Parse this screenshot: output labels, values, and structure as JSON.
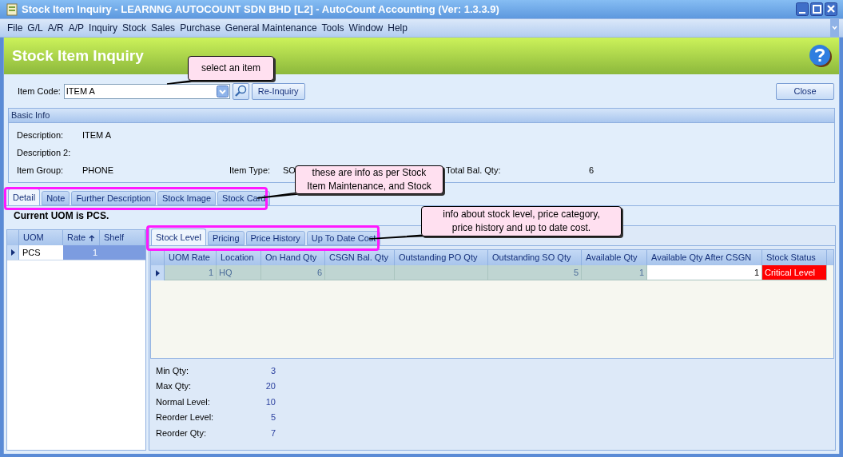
{
  "window": {
    "title": "Stock Item Inquiry - LEARNNG AUTOCOUNT SDN BHD [L2] - AutoCount Accounting (Ver: 1.3.3.9)"
  },
  "menu": [
    {
      "label": "File"
    },
    {
      "label": "G/L"
    },
    {
      "label": "A/R"
    },
    {
      "label": "A/P"
    },
    {
      "label": "Inquiry"
    },
    {
      "label": "Stock"
    },
    {
      "label": "Sales"
    },
    {
      "label": "Purchase"
    },
    {
      "label": "General Maintenance"
    },
    {
      "label": "Tools"
    },
    {
      "label": "Window"
    },
    {
      "label": "Help"
    }
  ],
  "header": {
    "title": "Stock Item Inquiry"
  },
  "item_code": {
    "label": "Item Code:",
    "value": "ITEM A"
  },
  "buttons": {
    "re_inquiry": "Re-Inquiry",
    "close": "Close"
  },
  "basic_info": {
    "title": "Basic Info",
    "rows": [
      [
        {
          "label": "Description:",
          "value": "ITEM A"
        }
      ],
      [
        {
          "label": "Description 2:"
        }
      ],
      [
        {
          "label": "Item Group:",
          "value": "PHONE"
        },
        {
          "label": "Item Type:",
          "value": "SO"
        },
        {
          "label": "Total Bal. Qty:",
          "value": "6"
        }
      ]
    ]
  },
  "tabs": [
    {
      "label": "Detail",
      "selected": true
    },
    {
      "label": "Note",
      "selected": false
    },
    {
      "label": "Further Description",
      "selected": false
    },
    {
      "label": "Stock Image",
      "selected": false
    },
    {
      "label": "Stock Card",
      "selected": false
    }
  ],
  "current_uom": "Current UOM is PCS.",
  "uom_grid": {
    "columns": [
      {
        "label": "UOM",
        "sorted": false
      },
      {
        "label": "Rate",
        "sorted": true
      },
      {
        "label": "Shelf",
        "sorted": false
      }
    ],
    "rows": [
      {
        "uom": "PCS",
        "rate": "1",
        "current": true
      }
    ]
  },
  "sub_tabs": [
    {
      "label": "Stock Level",
      "selected": true
    },
    {
      "label": "Pricing",
      "selected": false
    },
    {
      "label": "Price History",
      "selected": false
    },
    {
      "label": "Up To Date Cost",
      "selected": false
    }
  ],
  "stock_grid": {
    "columns": [
      {
        "kind": "number",
        "label": "UOM Rate"
      },
      {
        "kind": "text",
        "label": "Location"
      },
      {
        "kind": "number",
        "label": "On Hand Qty"
      },
      {
        "kind": "number",
        "label": "CSGN Bal. Qty"
      },
      {
        "kind": "number",
        "label": "Outstanding PO Qty"
      },
      {
        "kind": "number",
        "label": "Outstanding SO Qty"
      },
      {
        "kind": "number",
        "label": "Available Qty"
      },
      {
        "kind": "editable",
        "label": "Available Qty After CSGN"
      },
      {
        "kind": "status",
        "label": "Stock Status"
      }
    ],
    "rows": [
      {
        "current": true,
        "critical": true,
        "cells": [
          {
            "text": "1"
          },
          {
            "text": "HQ"
          },
          {
            "text": "6"
          },
          {},
          {},
          {
            "text": "5"
          },
          {
            "text": "1"
          },
          {
            "text": "1"
          },
          {
            "text": "Critical Level"
          }
        ]
      }
    ]
  },
  "levels": [
    {
      "label": "Min Qty:",
      "value": "3"
    },
    {
      "label": "Max Qty:",
      "value": "20"
    },
    {
      "label": "Normal Level:",
      "value": "10"
    },
    {
      "label": "Reorder Level:",
      "value": "5"
    },
    {
      "label": "Reorder Qty:",
      "value": "7"
    }
  ],
  "callouts": [
    {
      "text": "select an item"
    },
    {
      "text": "these are info as per Stock\nItem Maintenance, and Stock"
    },
    {
      "text": "info about stock level, price category,\nprice history and up to date cost."
    }
  ]
}
